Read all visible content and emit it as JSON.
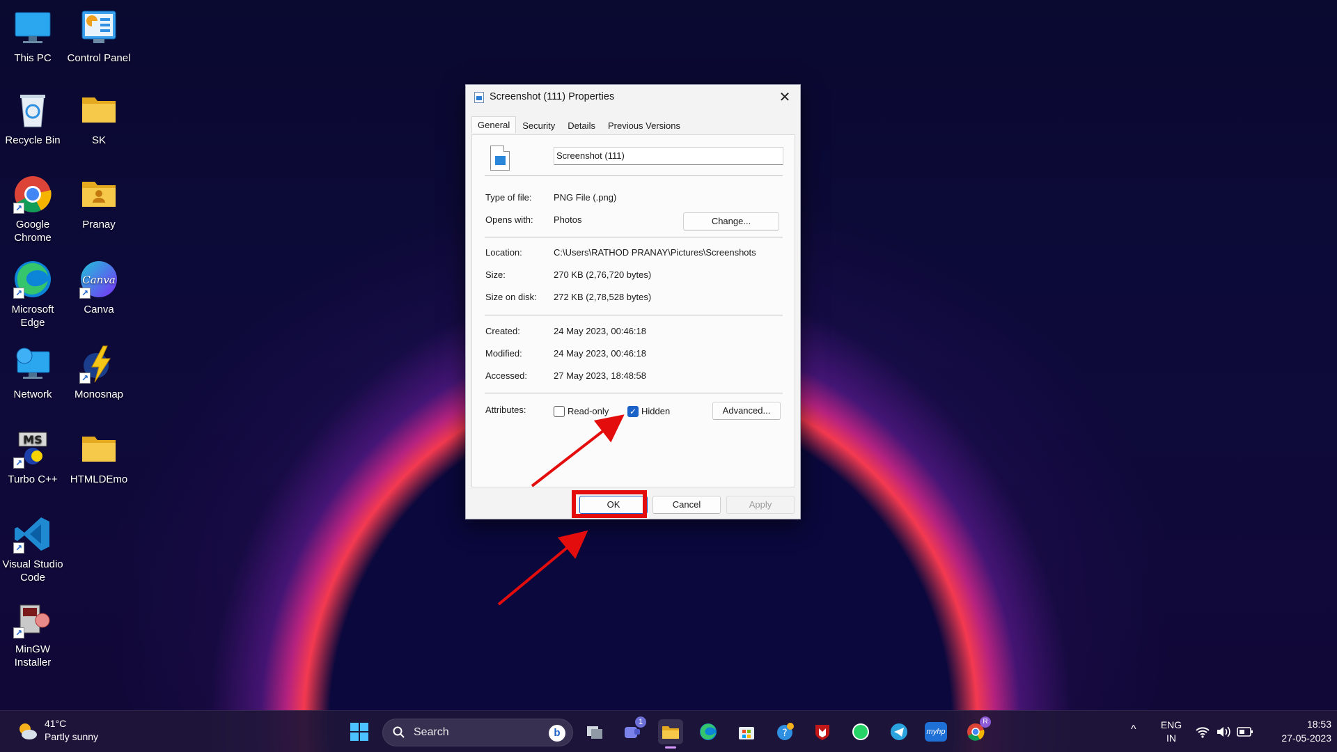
{
  "desktop": {
    "icons": [
      {
        "label1": "This PC",
        "label2": ""
      },
      {
        "label1": "Control Panel",
        "label2": ""
      },
      {
        "label1": "Recycle Bin",
        "label2": ""
      },
      {
        "label1": "SK",
        "label2": ""
      },
      {
        "label1": "Google",
        "label2": "Chrome"
      },
      {
        "label1": "Pranay",
        "label2": ""
      },
      {
        "label1": "Microsoft",
        "label2": "Edge"
      },
      {
        "label1": "Canva",
        "label2": ""
      },
      {
        "label1": "Network",
        "label2": ""
      },
      {
        "label1": "Monosnap",
        "label2": ""
      },
      {
        "label1": "Turbo C++",
        "label2": ""
      },
      {
        "label1": "HTMLDEmo",
        "label2": ""
      },
      {
        "label1": "Visual Studio",
        "label2": "Code"
      },
      {
        "label1": "MinGW",
        "label2": "Installer"
      }
    ],
    "canva_glyph": "Canva",
    "turbo_glyph": "MS"
  },
  "dialog": {
    "title": "Screenshot (111) Properties",
    "close_glyph": "✕",
    "tabs": [
      "General",
      "Security",
      "Details",
      "Previous Versions"
    ],
    "active_tab": "General",
    "file_name": "Screenshot (111)",
    "rows": {
      "type_label": "Type of file:",
      "type_value": "PNG File (.png)",
      "opens_label": "Opens with:",
      "opens_value": "Photos",
      "change_button": "Change...",
      "location_label": "Location:",
      "location_value": "C:\\Users\\RATHOD PRANAY\\Pictures\\Screenshots",
      "size_label": "Size:",
      "size_value": "270 KB (2,76,720 bytes)",
      "disk_label": "Size on disk:",
      "disk_value": "272 KB (2,78,528 bytes)",
      "created_label": "Created:",
      "created_value": "24 May 2023, 00:46:18",
      "modified_label": "Modified:",
      "modified_value": "24 May 2023, 00:46:18",
      "accessed_label": "Accessed:",
      "accessed_value": "27 May 2023, 18:48:58",
      "attributes_label": "Attributes:"
    },
    "attributes": {
      "readonly_label": "Read-only",
      "readonly_checked": false,
      "hidden_label": "Hidden",
      "hidden_checked": true,
      "check_glyph": "✓",
      "advanced_button": "Advanced..."
    },
    "footer": {
      "ok": "OK",
      "cancel": "Cancel",
      "apply": "Apply"
    }
  },
  "annotation_color": "#e30d0d",
  "taskbar": {
    "weather_temp": "41°C",
    "weather_desc": "Partly sunny",
    "search_placeholder": "Search",
    "bing_glyph": "b",
    "teams_badge": "1",
    "chrome_badge": "R",
    "tray_chevron": "^",
    "lang_top": "ENG",
    "lang_bottom": "IN",
    "time": "18:53",
    "date": "27-05-2023",
    "myhp_glyph": "myhp"
  }
}
